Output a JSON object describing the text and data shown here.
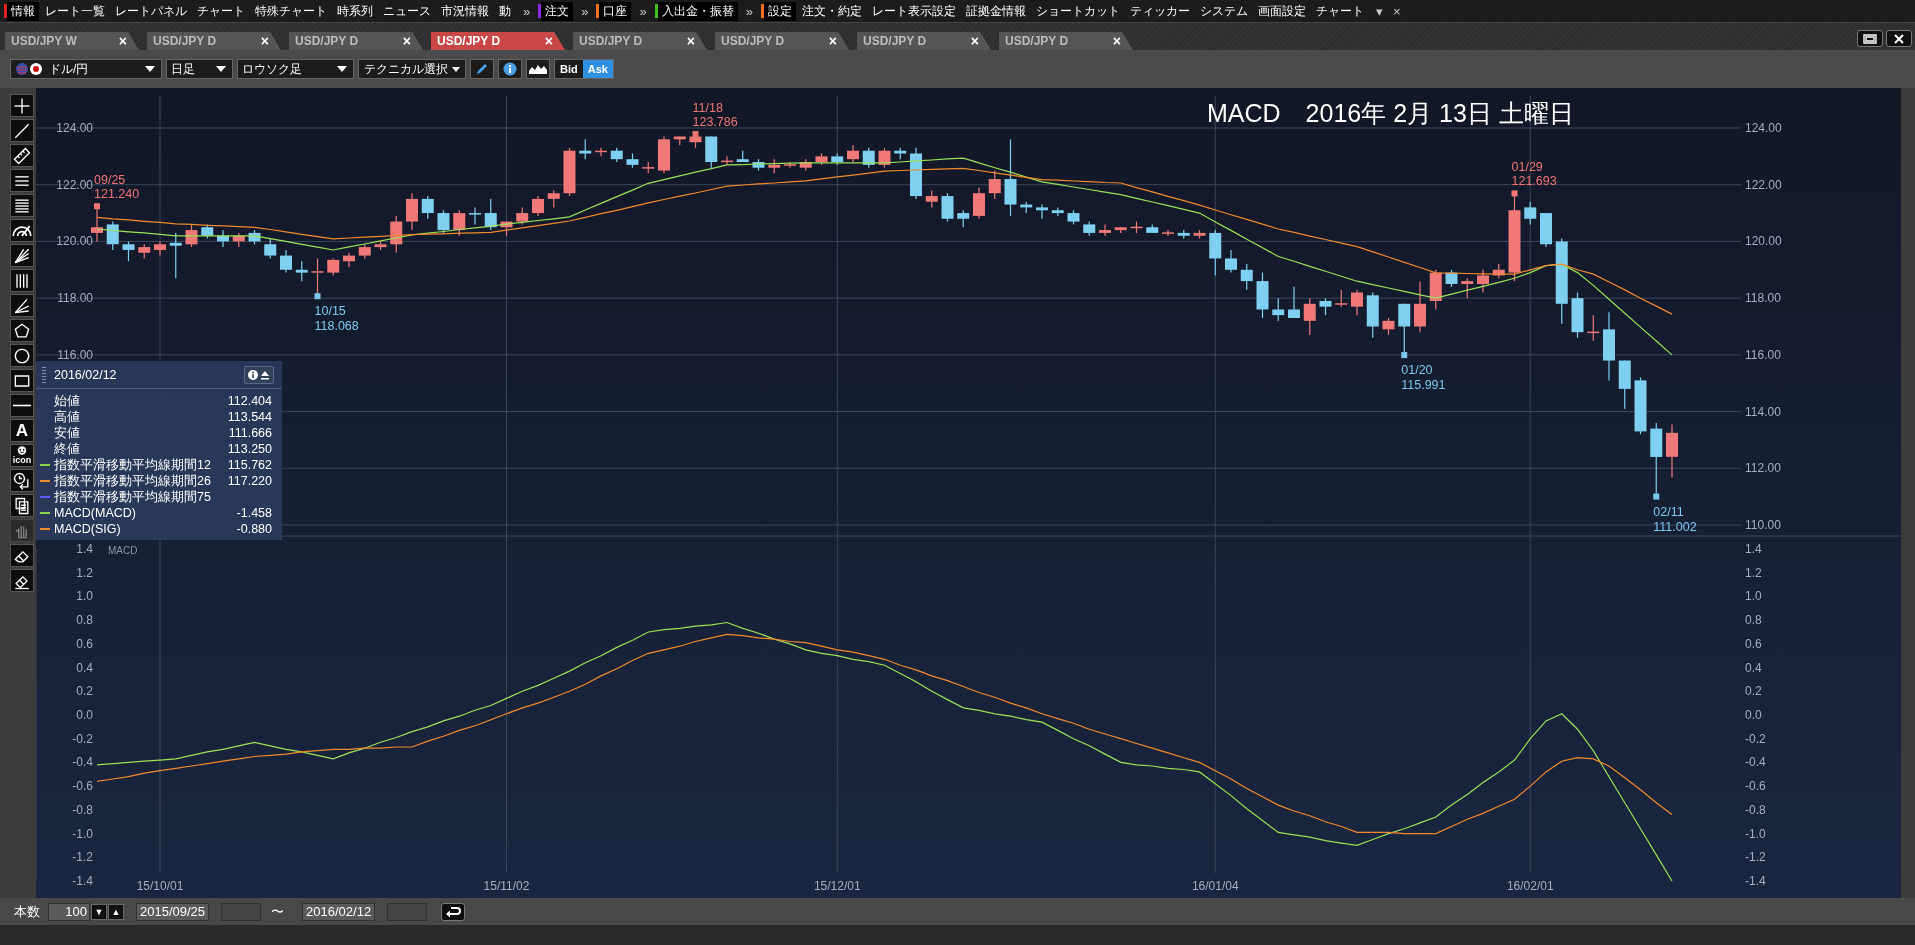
{
  "menu": [
    {
      "kind": "group",
      "label": "情報",
      "color": "#e02020"
    },
    {
      "kind": "item",
      "label": "レート一覧"
    },
    {
      "kind": "item",
      "label": "レートパネル"
    },
    {
      "kind": "item",
      "label": "チャート"
    },
    {
      "kind": "item",
      "label": "特殊チャート"
    },
    {
      "kind": "item",
      "label": "時系列"
    },
    {
      "kind": "item",
      "label": "ニュース"
    },
    {
      "kind": "item",
      "label": "市況情報"
    },
    {
      "kind": "item",
      "label": "動"
    },
    {
      "kind": "more",
      "label": "»"
    },
    {
      "kind": "group",
      "label": "注文",
      "color": "#8a2be2"
    },
    {
      "kind": "more",
      "label": "»"
    },
    {
      "kind": "group",
      "label": "口座",
      "color": "#f07020"
    },
    {
      "kind": "more",
      "label": "»"
    },
    {
      "kind": "group",
      "label": "入出金・振替",
      "color": "#40c020"
    },
    {
      "kind": "more",
      "label": "»"
    },
    {
      "kind": "group",
      "label": "設定",
      "color": "#f07020"
    },
    {
      "kind": "item",
      "label": "注文・約定"
    },
    {
      "kind": "item",
      "label": "レート表示設定"
    },
    {
      "kind": "item",
      "label": "証拠金情報"
    },
    {
      "kind": "item",
      "label": "ショートカット"
    },
    {
      "kind": "item",
      "label": "ティッカー"
    },
    {
      "kind": "item",
      "label": "システム"
    },
    {
      "kind": "item",
      "label": "画面設定"
    },
    {
      "kind": "item",
      "label": "チャート"
    },
    {
      "kind": "more",
      "label": "▾"
    },
    {
      "kind": "more",
      "label": "×"
    }
  ],
  "tabs": [
    {
      "label": "USD/JPY W",
      "close": "×",
      "selected": false
    },
    {
      "label": "USD/JPY D",
      "close": "×",
      "selected": false
    },
    {
      "label": "USD/JPY D",
      "close": "×",
      "selected": false
    },
    {
      "label": "USD/JPY D",
      "close": "×",
      "selected": true
    },
    {
      "label": "USD/JPY D",
      "close": "×",
      "selected": false
    },
    {
      "label": "USD/JPY D",
      "close": "×",
      "selected": false
    },
    {
      "label": "USD/JPY D",
      "close": "×",
      "selected": false
    },
    {
      "label": "USD/JPY D",
      "close": "×",
      "selected": false
    }
  ],
  "toolbar": {
    "symbol": "ドル/円",
    "period": "日足",
    "chart_type": "ロウソク足",
    "technical": "テクニカル選択",
    "quote": [
      {
        "label": "Bid",
        "selected": false
      },
      {
        "label": "Ask",
        "selected": true
      }
    ]
  },
  "tools": [
    {
      "kind": "crosshair",
      "disabled": false
    },
    {
      "kind": "line",
      "disabled": false
    },
    {
      "kind": "ruler",
      "disabled": false
    },
    {
      "kind": "hlines",
      "disabled": false
    },
    {
      "kind": "hlines-dense",
      "disabled": false
    },
    {
      "kind": "arc",
      "disabled": false
    },
    {
      "kind": "fan",
      "disabled": false
    },
    {
      "kind": "vlines",
      "disabled": false
    },
    {
      "kind": "fan2",
      "disabled": false
    },
    {
      "kind": "pentagon",
      "disabled": false
    },
    {
      "kind": "circle",
      "disabled": false
    },
    {
      "kind": "rectangle",
      "disabled": false
    },
    {
      "kind": "hline",
      "disabled": false
    },
    {
      "kind": "text",
      "label": "A",
      "disabled": false
    },
    {
      "kind": "stamp",
      "label": "icon",
      "disabled": false
    },
    {
      "kind": "clock",
      "disabled": false
    },
    {
      "kind": "copy",
      "disabled": false
    },
    {
      "kind": "hand",
      "disabled": true
    },
    {
      "kind": "eraser",
      "disabled": false
    },
    {
      "kind": "eraser2",
      "disabled": false
    }
  ],
  "title": "MACD　2016年 2月 13日 土曜日",
  "price_chart": {
    "chart_data": {
      "type": "candlestick",
      "grid": true,
      "ylim": [
        110,
        124
      ],
      "categories": [
        null,
        null,
        null,
        null,
        null,
        null,
        null,
        null,
        null,
        null,
        null,
        null,
        null,
        null,
        null,
        null,
        null,
        null,
        null,
        null,
        null,
        null,
        null,
        null,
        null,
        null,
        null,
        null,
        null,
        null,
        null,
        null,
        null,
        null,
        null,
        null,
        null,
        null,
        null,
        null,
        null,
        null,
        null,
        null,
        null,
        null,
        null,
        null,
        null,
        null,
        null,
        null,
        null,
        null,
        null,
        null,
        null,
        null,
        null,
        null,
        null,
        null,
        null,
        null,
        null,
        null,
        null,
        null,
        null,
        null,
        null,
        null,
        null,
        null,
        null,
        null,
        null,
        null,
        null,
        null,
        null,
        null,
        null,
        null,
        null,
        null,
        null,
        null,
        null,
        null,
        null,
        null,
        null,
        null,
        null,
        null,
        null,
        null,
        null,
        null,
        null
      ],
      "yticks": [
        {
          "value": 124,
          "label": "124.00"
        },
        {
          "value": 122,
          "label": "122.00"
        },
        {
          "value": 120,
          "label": "120.00"
        },
        {
          "value": 118,
          "label": "118.00"
        },
        {
          "value": 116,
          "label": "116.00"
        },
        {
          "value": 114,
          "label": "114.00"
        },
        {
          "value": 112,
          "label": "112.00"
        },
        {
          "value": 110,
          "label": "110.00"
        }
      ],
      "ohlc": [
        [
          120.3,
          121.24,
          120.0,
          120.5
        ],
        [
          120.6,
          120.7,
          119.7,
          119.9
        ],
        [
          119.9,
          120.0,
          119.3,
          119.7
        ],
        [
          119.6,
          119.9,
          119.4,
          119.8
        ],
        [
          119.7,
          120.0,
          119.5,
          119.9
        ],
        [
          119.95,
          120.3,
          118.7,
          119.85
        ],
        [
          119.9,
          120.6,
          119.8,
          120.4
        ],
        [
          120.5,
          120.6,
          120.1,
          120.2
        ],
        [
          120.2,
          120.4,
          119.8,
          120.0
        ],
        [
          120.0,
          120.3,
          119.8,
          120.2
        ],
        [
          120.3,
          120.4,
          119.9,
          120.0
        ],
        [
          119.9,
          120.1,
          119.4,
          119.5
        ],
        [
          119.5,
          119.7,
          118.9,
          119.0
        ],
        [
          119.0,
          119.3,
          118.6,
          118.9
        ],
        [
          118.9,
          119.4,
          118.068,
          118.95
        ],
        [
          118.9,
          119.4,
          118.8,
          119.35
        ],
        [
          119.3,
          119.6,
          119.1,
          119.5
        ],
        [
          119.5,
          119.9,
          119.4,
          119.8
        ],
        [
          119.8,
          120.0,
          119.7,
          119.9
        ],
        [
          119.9,
          120.9,
          119.6,
          120.7
        ],
        [
          120.7,
          121.7,
          120.4,
          121.5
        ],
        [
          121.5,
          121.6,
          120.8,
          121.0
        ],
        [
          121.0,
          121.1,
          120.3,
          120.4
        ],
        [
          120.4,
          121.1,
          120.2,
          121.0
        ],
        [
          121.0,
          121.2,
          120.6,
          120.95
        ],
        [
          121.0,
          121.5,
          120.4,
          120.5
        ],
        [
          120.5,
          120.7,
          120.2,
          120.7
        ],
        [
          120.7,
          121.2,
          120.6,
          121.0
        ],
        [
          121.0,
          121.6,
          120.9,
          121.5
        ],
        [
          121.5,
          121.8,
          121.2,
          121.7
        ],
        [
          121.7,
          123.3,
          121.6,
          123.2
        ],
        [
          123.2,
          123.6,
          122.9,
          123.1
        ],
        [
          123.2,
          123.3,
          123.0,
          123.2
        ],
        [
          123.2,
          123.3,
          122.8,
          122.9
        ],
        [
          122.9,
          123.1,
          122.6,
          122.7
        ],
        [
          122.6,
          122.8,
          122.4,
          122.62
        ],
        [
          122.5,
          123.7,
          122.4,
          123.6
        ],
        [
          123.6,
          123.7,
          123.4,
          123.7
        ],
        [
          123.5,
          123.786,
          123.3,
          123.7
        ],
        [
          123.7,
          123.7,
          122.6,
          122.8
        ],
        [
          122.8,
          123.0,
          122.7,
          122.85
        ],
        [
          122.9,
          123.2,
          122.8,
          122.8
        ],
        [
          122.8,
          122.9,
          122.5,
          122.6
        ],
        [
          122.6,
          122.9,
          122.4,
          122.7
        ],
        [
          122.7,
          122.8,
          122.6,
          122.72
        ],
        [
          122.6,
          122.9,
          122.5,
          122.8
        ],
        [
          122.8,
          123.1,
          122.7,
          123.0
        ],
        [
          123.0,
          123.1,
          122.7,
          122.8
        ],
        [
          122.9,
          123.4,
          122.8,
          123.2
        ],
        [
          123.2,
          123.3,
          122.6,
          122.7
        ],
        [
          122.7,
          123.3,
          122.6,
          123.2
        ],
        [
          123.2,
          123.3,
          122.9,
          123.1
        ],
        [
          123.1,
          123.3,
          121.5,
          121.6
        ],
        [
          121.4,
          121.8,
          121.2,
          121.6
        ],
        [
          121.6,
          121.7,
          120.7,
          120.8
        ],
        [
          121.0,
          121.1,
          120.5,
          120.8
        ],
        [
          120.9,
          121.9,
          120.8,
          121.7
        ],
        [
          121.7,
          122.5,
          121.5,
          122.2
        ],
        [
          122.2,
          123.6,
          120.9,
          121.3
        ],
        [
          121.3,
          121.4,
          121.0,
          121.2
        ],
        [
          121.2,
          121.3,
          120.8,
          121.1
        ],
        [
          121.1,
          121.2,
          120.9,
          121.0
        ],
        [
          121.0,
          121.1,
          120.6,
          120.7
        ],
        [
          120.6,
          120.7,
          120.2,
          120.3
        ],
        [
          120.3,
          120.6,
          120.2,
          120.4
        ],
        [
          120.4,
          120.5,
          120.3,
          120.5
        ],
        [
          120.5,
          120.7,
          120.3,
          120.52
        ],
        [
          120.5,
          120.6,
          120.3,
          120.3
        ],
        [
          120.3,
          120.4,
          120.2,
          120.32
        ],
        [
          120.3,
          120.4,
          120.1,
          120.2
        ],
        [
          120.2,
          120.4,
          120.1,
          120.3
        ],
        [
          120.3,
          120.4,
          118.8,
          119.4
        ],
        [
          119.4,
          119.7,
          118.9,
          119.0
        ],
        [
          119.0,
          119.2,
          118.3,
          118.6
        ],
        [
          118.6,
          118.9,
          117.3,
          117.6
        ],
        [
          117.6,
          118.0,
          117.2,
          117.4
        ],
        [
          117.6,
          118.4,
          117.3,
          117.3
        ],
        [
          117.2,
          118.0,
          116.7,
          117.8
        ],
        [
          117.9,
          118.0,
          117.4,
          117.7
        ],
        [
          117.8,
          118.3,
          117.7,
          117.82
        ],
        [
          117.7,
          118.3,
          117.4,
          118.2
        ],
        [
          118.1,
          118.2,
          116.6,
          117.0
        ],
        [
          116.9,
          117.3,
          116.7,
          117.2
        ],
        [
          117.8,
          117.8,
          115.991,
          117.0
        ],
        [
          117.0,
          118.6,
          116.8,
          117.8
        ],
        [
          117.9,
          119.0,
          117.6,
          118.9
        ],
        [
          118.9,
          119.0,
          118.4,
          118.5
        ],
        [
          118.5,
          118.7,
          118.0,
          118.6
        ],
        [
          118.5,
          119.0,
          118.2,
          118.8
        ],
        [
          118.8,
          119.2,
          118.7,
          119.0
        ],
        [
          118.9,
          121.693,
          118.6,
          121.1
        ],
        [
          121.2,
          121.4,
          120.6,
          120.8
        ],
        [
          121.0,
          121.0,
          119.8,
          119.9
        ],
        [
          120.0,
          120.1,
          117.1,
          117.8
        ],
        [
          118.0,
          118.2,
          116.6,
          116.8
        ],
        [
          116.8,
          117.4,
          116.5,
          116.82
        ],
        [
          116.9,
          117.5,
          115.1,
          115.8
        ],
        [
          115.8,
          115.8,
          114.1,
          114.8
        ],
        [
          115.1,
          115.2,
          113.2,
          113.3
        ],
        [
          113.4,
          113.6,
          111.002,
          112.4
        ],
        [
          112.404,
          113.544,
          111.666,
          113.25
        ]
      ],
      "annotations": [
        {
          "text": "09/25"
        },
        {
          "text": "121.240"
        },
        {
          "text": "10/15"
        },
        {
          "text": "118.068"
        },
        {
          "text": "11/18"
        },
        {
          "text": "123.786"
        },
        {
          "text": "01/20"
        },
        {
          "text": "115.991"
        },
        {
          "text": "01/29"
        },
        {
          "text": "121.693"
        },
        {
          "text": "02/11"
        },
        {
          "text": "111.002"
        }
      ]
    }
  },
  "moving_averages": {
    "chart_data": {
      "type": "line",
      "ylim": [
        116,
        124
      ],
      "categories": [
        null,
        null,
        null,
        null,
        null,
        null,
        null,
        null,
        null,
        null,
        null,
        null,
        null,
        null,
        null,
        null,
        null,
        null,
        null,
        null,
        null,
        null,
        null,
        null,
        null,
        null,
        null,
        null,
        null,
        null,
        null,
        null,
        null,
        null,
        null,
        null,
        null,
        null,
        null,
        null,
        null,
        null,
        null,
        null,
        null,
        null,
        null,
        null,
        null,
        null,
        null,
        null,
        null,
        null,
        null,
        null,
        null,
        null,
        null,
        null,
        null,
        null,
        null,
        null,
        null,
        null,
        null,
        null,
        null,
        null,
        null,
        null,
        null,
        null,
        null,
        null,
        null,
        null,
        null,
        null,
        null,
        null,
        null,
        null,
        null,
        null,
        null,
        null,
        null,
        null,
        null,
        null,
        null,
        null,
        null,
        null,
        null,
        null,
        null,
        null,
        null
      ],
      "yticks": [
        {
          "value": 124,
          "label": "124.00"
        },
        {
          "value": 122,
          "label": "122.00"
        },
        {
          "value": 120,
          "label": "120.00"
        },
        {
          "value": 118,
          "label": "118.00"
        },
        {
          "value": 116,
          "label": "116.00"
        }
      ],
      "series": [
        {
          "color": "#9be05a",
          "values": [
            120.44,
            120.39,
            120.34,
            120.3,
            120.25,
            120.2,
            120.2,
            120.2,
            120.2,
            120.2,
            120.2,
            120.1,
            120.0,
            119.9,
            119.8,
            119.7,
            119.81,
            119.91,
            120.02,
            120.12,
            120.23,
            120.29,
            120.35,
            120.42,
            120.48,
            120.54,
            120.61,
            120.67,
            120.74,
            120.8,
            120.87,
            121.11,
            121.34,
            121.58,
            121.81,
            122.05,
            122.18,
            122.31,
            122.44,
            122.57,
            122.7,
            122.71,
            122.73,
            122.74,
            122.76,
            122.77,
            122.77,
            122.77,
            122.77,
            122.77,
            122.77,
            122.8,
            122.84,
            122.87,
            122.91,
            122.94,
            122.77,
            122.6,
            122.44,
            122.27,
            122.1,
            122.01,
            121.92,
            121.83,
            121.74,
            121.65,
            121.52,
            121.39,
            121.26,
            121.13,
            121.0,
            120.69,
            120.39,
            120.08,
            119.78,
            119.47,
            119.3,
            119.12,
            118.95,
            118.77,
            118.6,
            118.48,
            118.36,
            118.24,
            118.12,
            118.0,
            118.14,
            118.28,
            118.42,
            118.56,
            118.7,
            118.9,
            119.15,
            119.2,
            118.9,
            118.45,
            117.96,
            117.47,
            116.98,
            116.49,
            116.0
          ]
        },
        {
          "color": "#f08a30",
          "values": [
            120.85,
            120.8,
            120.76,
            120.71,
            120.67,
            120.62,
            120.6,
            120.57,
            120.55,
            120.52,
            120.5,
            120.42,
            120.34,
            120.25,
            120.17,
            120.09,
            120.12,
            120.15,
            120.18,
            120.21,
            120.24,
            120.26,
            120.27,
            120.29,
            120.3,
            120.32,
            120.4,
            120.48,
            120.56,
            120.64,
            120.72,
            120.85,
            120.98,
            121.1,
            121.23,
            121.36,
            121.48,
            121.6,
            121.71,
            121.83,
            121.95,
            121.99,
            122.03,
            122.06,
            122.1,
            122.14,
            122.21,
            122.28,
            122.34,
            122.41,
            122.48,
            122.5,
            122.52,
            122.54,
            122.56,
            122.58,
            122.5,
            122.42,
            122.34,
            122.26,
            122.18,
            122.16,
            122.13,
            122.11,
            122.08,
            122.06,
            121.9,
            121.75,
            121.59,
            121.44,
            121.28,
            121.11,
            120.94,
            120.78,
            120.61,
            120.44,
            120.32,
            120.19,
            120.07,
            119.94,
            119.82,
            119.63,
            119.45,
            119.26,
            119.08,
            118.89,
            118.88,
            118.87,
            118.86,
            118.85,
            118.85,
            119.0,
            119.15,
            119.2,
            119.0,
            118.85,
            118.57,
            118.29,
            118.0,
            117.72,
            117.44
          ]
        }
      ]
    }
  },
  "macd_chart": {
    "label": "MACD",
    "left_axis": [
      "1.4",
      "1.2",
      "1.0",
      "0.8",
      "0.6",
      "0.4",
      "0.2",
      "0.0",
      "-0.2",
      "-0.4",
      "-0.6",
      "-0.8",
      "-1.0",
      "-1.2",
      "-1.4"
    ],
    "chart_data": {
      "type": "line",
      "ylim": [
        -1.4,
        1.4
      ],
      "categories": [
        null,
        null,
        null,
        null,
        "15/10/01",
        null,
        null,
        null,
        null,
        null,
        null,
        null,
        null,
        null,
        null,
        null,
        null,
        null,
        null,
        null,
        null,
        null,
        null,
        null,
        null,
        null,
        "15/11/02",
        null,
        null,
        null,
        null,
        null,
        null,
        null,
        null,
        null,
        null,
        null,
        null,
        null,
        null,
        null,
        null,
        null,
        null,
        null,
        null,
        "15/12/01",
        null,
        null,
        null,
        null,
        null,
        null,
        null,
        null,
        null,
        null,
        null,
        null,
        null,
        null,
        null,
        null,
        null,
        null,
        null,
        null,
        null,
        null,
        null,
        "16/01/04",
        null,
        null,
        null,
        null,
        null,
        null,
        null,
        null,
        null,
        null,
        null,
        null,
        null,
        null,
        null,
        null,
        null,
        null,
        null,
        "16/02/01",
        null,
        null,
        null,
        null,
        null,
        null,
        null,
        null,
        null
      ],
      "yticks": [
        {
          "value": 1.4,
          "label": "1.4"
        },
        {
          "value": 1.2,
          "label": "1.2"
        },
        {
          "value": 1.0,
          "label": "1.0"
        },
        {
          "value": 0.8,
          "label": "0.8"
        },
        {
          "value": 0.6,
          "label": "0.6"
        },
        {
          "value": 0.4,
          "label": "0.4"
        },
        {
          "value": 0.2,
          "label": "0.2"
        },
        {
          "value": 0,
          "label": "0.0"
        },
        {
          "value": -0.2,
          "label": "-0.2"
        },
        {
          "value": -0.4,
          "label": "-0.4"
        },
        {
          "value": -0.6,
          "label": "-0.6"
        },
        {
          "value": -0.8,
          "label": "-0.8"
        },
        {
          "value": -1.0,
          "label": "-1.0"
        },
        {
          "value": -1.2,
          "label": "-1.2"
        },
        {
          "value": -1.4,
          "label": "-1.4"
        }
      ],
      "series": [
        {
          "color": "#9be05a",
          "values": [
            -0.42,
            -0.41,
            -0.4,
            -0.39,
            -0.38,
            -0.37,
            -0.34,
            -0.31,
            -0.29,
            -0.26,
            -0.23,
            -0.26,
            -0.29,
            -0.31,
            -0.34,
            -0.37,
            -0.32,
            -0.28,
            -0.23,
            -0.19,
            -0.14,
            -0.1,
            -0.05,
            -0.01,
            0.04,
            0.08,
            0.14,
            0.2,
            0.25,
            0.31,
            0.37,
            0.44,
            0.5,
            0.57,
            0.63,
            0.7,
            0.72,
            0.73,
            0.75,
            0.76,
            0.78,
            0.73,
            0.69,
            0.64,
            0.6,
            0.55,
            0.52,
            0.5,
            0.47,
            0.45,
            0.42,
            0.35,
            0.28,
            0.2,
            0.13,
            0.06,
            0.04,
            0.01,
            -0.01,
            -0.04,
            -0.06,
            -0.13,
            -0.2,
            -0.26,
            -0.33,
            -0.4,
            -0.42,
            -0.43,
            -0.45,
            -0.46,
            -0.48,
            -0.58,
            -0.68,
            -0.79,
            -0.89,
            -0.99,
            -1.01,
            -1.03,
            -1.06,
            -1.08,
            -1.1,
            -1.05,
            -1.0,
            -0.96,
            -0.91,
            -0.86,
            -0.76,
            -0.67,
            -0.57,
            -0.48,
            -0.38,
            -0.2,
            -0.05,
            0.01,
            -0.12,
            -0.3,
            -0.52,
            -0.74,
            -0.96,
            -1.18,
            -1.4
          ]
        },
        {
          "color": "#f08a30",
          "values": [
            -0.56,
            -0.54,
            -0.52,
            -0.49,
            -0.47,
            -0.45,
            -0.43,
            -0.41,
            -0.39,
            -0.37,
            -0.35,
            -0.34,
            -0.33,
            -0.31,
            -0.3,
            -0.29,
            -0.29,
            -0.28,
            -0.28,
            -0.27,
            -0.27,
            -0.22,
            -0.18,
            -0.13,
            -0.09,
            -0.04,
            0.01,
            0.06,
            0.1,
            0.15,
            0.2,
            0.26,
            0.33,
            0.39,
            0.46,
            0.52,
            0.55,
            0.58,
            0.62,
            0.65,
            0.68,
            0.67,
            0.65,
            0.64,
            0.62,
            0.61,
            0.58,
            0.55,
            0.53,
            0.5,
            0.47,
            0.42,
            0.38,
            0.33,
            0.29,
            0.24,
            0.19,
            0.15,
            0.1,
            0.06,
            0.01,
            -0.03,
            -0.07,
            -0.12,
            -0.16,
            -0.2,
            -0.24,
            -0.28,
            -0.32,
            -0.36,
            -0.4,
            -0.47,
            -0.54,
            -0.62,
            -0.69,
            -0.76,
            -0.81,
            -0.85,
            -0.9,
            -0.94,
            -0.99,
            -0.99,
            -0.99,
            -1.0,
            -1.0,
            -1.0,
            -0.94,
            -0.88,
            -0.83,
            -0.77,
            -0.71,
            -0.6,
            -0.48,
            -0.39,
            -0.36,
            -0.37,
            -0.43,
            -0.53,
            -0.63,
            -0.74,
            -0.84
          ]
        }
      ]
    }
  },
  "info_panel": {
    "date": "2016/02/12",
    "rows": [
      {
        "label": "始値",
        "value": "112.404"
      },
      {
        "label": "高値",
        "value": "113.544"
      },
      {
        "label": "安値",
        "value": "111.666"
      },
      {
        "label": "終値",
        "value": "113.250"
      },
      {
        "label": "指数平滑移動平均線期間12",
        "value": "115.762",
        "color": "#8fd14f"
      },
      {
        "label": "指数平滑移動平均線期間26",
        "value": "117.220",
        "color": "#f08a30"
      },
      {
        "label": "指数平滑移動平均線期間75",
        "color": "#5a5aff"
      },
      {
        "label": "MACD(MACD)",
        "value": "-1.458",
        "color": "#8fd14f"
      },
      {
        "label": "MACD(SIG)",
        "value": "-0.880",
        "color": "#f08a30"
      }
    ]
  },
  "bottom": {
    "count_label": "本数",
    "count": "100",
    "down": "▼",
    "up": "▲",
    "from": "2015/09/25",
    "tilde": "〜",
    "to": "2016/02/12"
  }
}
